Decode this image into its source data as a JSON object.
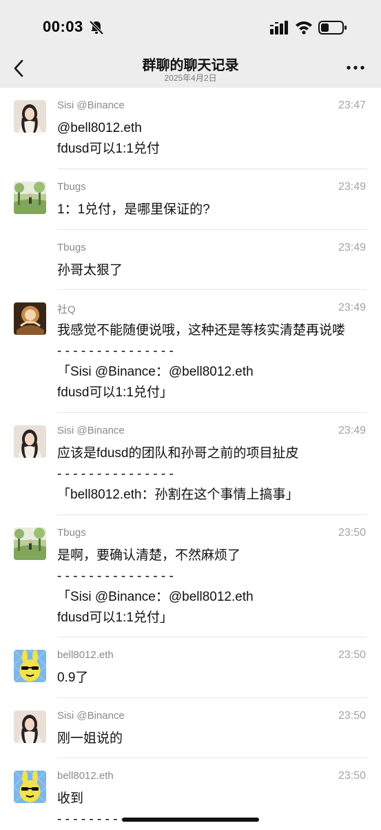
{
  "status_bar": {
    "time": "00:03"
  },
  "nav": {
    "title": "群聊的聊天记录",
    "subtitle": "2025年4月2日"
  },
  "messages": [
    {
      "sender": "Sisi @Binance",
      "time": "23:47",
      "text": "@bell8012.eth\nfdusd可以1:1兑付",
      "avatar": "sisi"
    },
    {
      "sender": "Tbugs",
      "time": "23:49",
      "text": "1：1兑付，是哪里保证的?",
      "avatar": "tbugs"
    },
    {
      "sender": "Tbugs",
      "time": "23:49",
      "text": "孙哥太狠了",
      "avatar": "none"
    },
    {
      "sender": "社Q",
      "time": "23:49",
      "text": "我感觉不能随便说哦，这种还是等核实清楚再说喽\n- - - - - - - - - - - - - - -\n「Sisi @Binance：@bell8012.eth\nfdusd可以1:1兑付」",
      "avatar": "sheq"
    },
    {
      "sender": "Sisi @Binance",
      "time": "23:49",
      "text": "应该是fdusd的团队和孙哥之前的项目扯皮\n- - - - - - - - - - - - - - -\n「bell8012.eth：孙割在这个事情上搞事」",
      "avatar": "sisi"
    },
    {
      "sender": "Tbugs",
      "time": "23:50",
      "text": "是啊，要确认清楚，不然麻烦了\n- - - - - - - - - - - - - - -\n「Sisi @Binance：@bell8012.eth\nfdusd可以1:1兑付」",
      "avatar": "tbugs"
    },
    {
      "sender": "bell8012.eth",
      "time": "23:50",
      "text": "0.9了",
      "avatar": "bell"
    },
    {
      "sender": "Sisi @Binance",
      "time": "23:50",
      "text": "刚一姐说的",
      "avatar": "sisi"
    },
    {
      "sender": "bell8012.eth",
      "time": "23:50",
      "text": "收到\n- - - - - - - - - -",
      "avatar": "bell"
    }
  ],
  "colors": {
    "nav_bg": "#ededed",
    "divider": "#e6e6e6",
    "meta_text": "#8a8a8a"
  },
  "icons": [
    "bell-off-icon",
    "signal-icon",
    "wifi-icon",
    "battery-icon",
    "back-icon",
    "more-icon"
  ]
}
